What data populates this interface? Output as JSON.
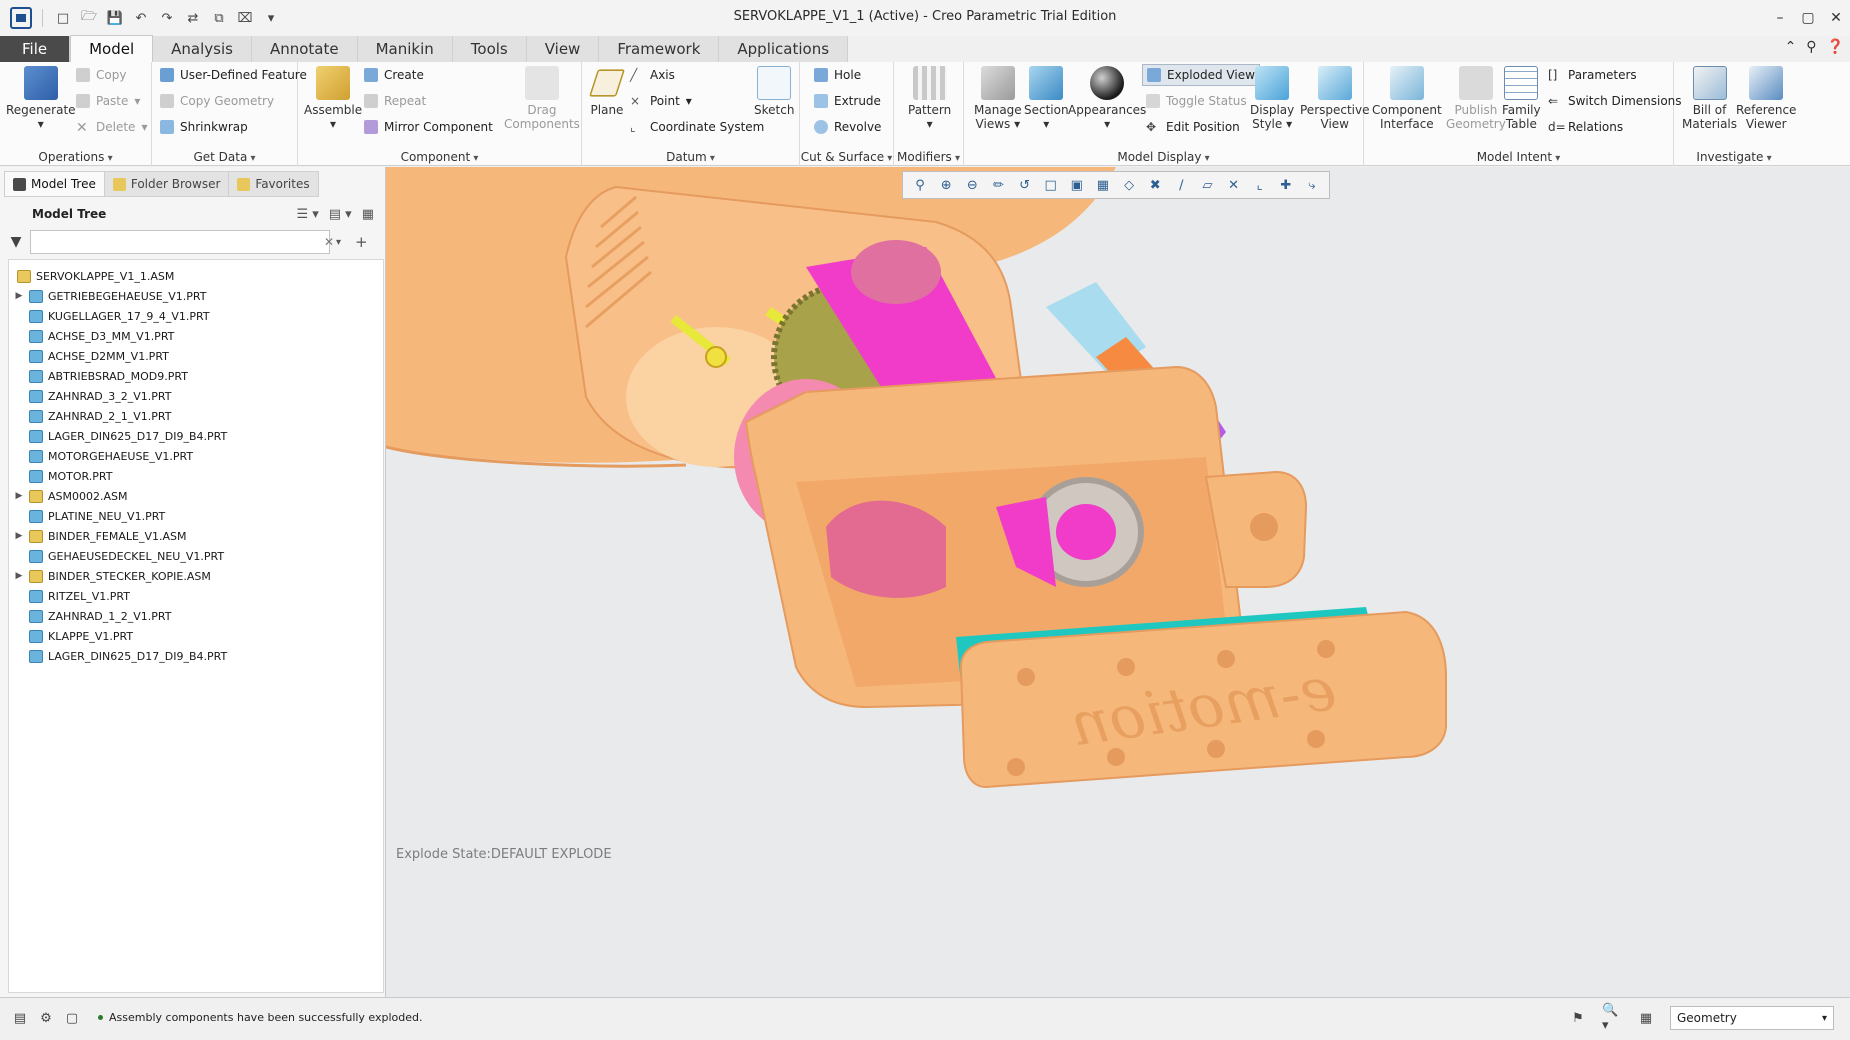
{
  "window": {
    "title": "SERVOKLAPPE_V1_1 (Active) - Creo Parametric Trial Edition"
  },
  "ribbon_tabs": [
    "File",
    "Model",
    "Analysis",
    "Annotate",
    "Manikin",
    "Tools",
    "View",
    "Framework",
    "Applications"
  ],
  "ribbon": {
    "operations": {
      "label": "Operations",
      "regenerate": "Regenerate",
      "copy": "Copy",
      "paste": "Paste",
      "delete": "Delete"
    },
    "get_data": {
      "label": "Get Data",
      "udf": "User-Defined Feature",
      "copy_geometry": "Copy Geometry",
      "shrinkwrap": "Shrinkwrap"
    },
    "component": {
      "label": "Component",
      "assemble": "Assemble",
      "create": "Create",
      "repeat": "Repeat",
      "mirror": "Mirror Component",
      "drag_1": "Drag",
      "drag_2": "Components"
    },
    "datum": {
      "label": "Datum",
      "plane": "Plane",
      "axis": "Axis",
      "point": "Point",
      "csys": "Coordinate System",
      "sketch": "Sketch"
    },
    "cut_surface": {
      "label": "Cut & Surface",
      "hole": "Hole",
      "extrude": "Extrude",
      "revolve": "Revolve"
    },
    "modifiers": {
      "label": "Modifiers",
      "pattern": "Pattern"
    },
    "model_display": {
      "label": "Model Display",
      "manage_1": "Manage",
      "manage_2": "Views",
      "section": "Section",
      "appearances": "Appearances",
      "exploded": "Exploded View",
      "toggle_status": "Toggle Status",
      "edit_position": "Edit Position",
      "display_1": "Display",
      "display_2": "Style",
      "persp_1": "Perspective",
      "persp_2": "View"
    },
    "model_intent": {
      "label": "Model Intent",
      "comp_1": "Component",
      "comp_2": "Interface",
      "publish_1": "Publish",
      "publish_2": "Geometry",
      "family_1": "Family",
      "family_2": "Table",
      "parameters": "Parameters",
      "switch_dims": "Switch Dimensions",
      "relations": "Relations"
    },
    "investigate": {
      "label": "Investigate",
      "bom_1": "Bill of",
      "bom_2": "Materials",
      "ref_1": "Reference",
      "ref_2": "Viewer"
    }
  },
  "panel": {
    "tabs": [
      "Model Tree",
      "Folder Browser",
      "Favorites"
    ],
    "tree_title": "Model Tree",
    "filter_value": "",
    "root": "SERVOKLAPPE_V1_1.ASM",
    "items": [
      {
        "name": "GETRIEBEGEHAEUSE_V1.PRT",
        "expandable": true,
        "type": "prt"
      },
      {
        "name": "KUGELLAGER_17_9_4_V1.PRT",
        "expandable": false,
        "type": "prt"
      },
      {
        "name": "ACHSE_D3_MM_V1.PRT",
        "expandable": false,
        "type": "prt"
      },
      {
        "name": "ACHSE_D2MM_V1.PRT",
        "expandable": false,
        "type": "prt"
      },
      {
        "name": "ABTRIEBSRAD_MOD9.PRT",
        "expandable": false,
        "type": "prt"
      },
      {
        "name": "ZAHNRAD_3_2_V1.PRT",
        "expandable": false,
        "type": "prt"
      },
      {
        "name": "ZAHNRAD_2_1_V1.PRT",
        "expandable": false,
        "type": "prt"
      },
      {
        "name": "LAGER_DIN625_D17_DI9_B4.PRT",
        "expandable": false,
        "type": "prt"
      },
      {
        "name": "MOTORGEHAEUSE_V1.PRT",
        "expandable": false,
        "type": "prt"
      },
      {
        "name": "MOTOR.PRT",
        "expandable": false,
        "type": "prt"
      },
      {
        "name": "ASM0002.ASM",
        "expandable": true,
        "type": "asm"
      },
      {
        "name": "PLATINE_NEU_V1.PRT",
        "expandable": false,
        "type": "prt"
      },
      {
        "name": "BINDER_FEMALE_V1.ASM",
        "expandable": true,
        "type": "asm"
      },
      {
        "name": "GEHAEUSEDECKEL_NEU_V1.PRT",
        "expandable": false,
        "type": "prt"
      },
      {
        "name": "BINDER_STECKER_KOPIE.ASM",
        "expandable": true,
        "type": "asm"
      },
      {
        "name": "RITZEL_V1.PRT",
        "expandable": false,
        "type": "prt"
      },
      {
        "name": "ZAHNRAD_1_2_V1.PRT",
        "expandable": false,
        "type": "prt"
      },
      {
        "name": "KLAPPE_V1.PRT",
        "expandable": false,
        "type": "prt"
      },
      {
        "name": "LAGER_DIN625_D17_DI9_B4.PRT",
        "expandable": false,
        "type": "prt"
      }
    ]
  },
  "viewport": {
    "explode_state": "Explode State:DEFAULT EXPLODE",
    "logo_text": "e-motion"
  },
  "status": {
    "message": "Assembly components have been successfully exploded.",
    "filter_select": "Geometry"
  },
  "colors": {
    "housing": "#f6b87a",
    "housing_dark": "#e59a5e",
    "gear_olive": "#a8a24a",
    "magenta": "#f03cc8",
    "pink": "#f58ab0",
    "teal": "#1ec8c0",
    "light_blue": "#a9dcee",
    "purple": "#b45ae6",
    "yellow": "#e8e83a"
  }
}
